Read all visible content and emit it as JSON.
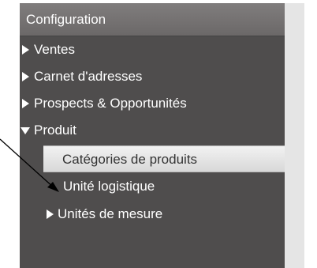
{
  "menu": {
    "header": "Configuration",
    "items": [
      {
        "label": "Ventes",
        "icon": "triangle-right-icon"
      },
      {
        "label": "Carnet d'adresses",
        "icon": "triangle-right-icon"
      },
      {
        "label": "Prospects & Opportunités",
        "icon": "triangle-right-icon"
      },
      {
        "label": "Produit",
        "icon": "triangle-down-icon",
        "expanded": true
      }
    ],
    "children": [
      {
        "label": "Catégories de produits",
        "selected": true
      },
      {
        "label": "Unité logistique"
      },
      {
        "label": "Unités de mesure",
        "icon": "triangle-right-icon"
      }
    ]
  },
  "colors": {
    "menu_background": "#4f4d4d",
    "header_background": "#7a7777",
    "selected_background": "#e8e8e8",
    "text": "#ffffff",
    "selected_text": "#333333"
  }
}
